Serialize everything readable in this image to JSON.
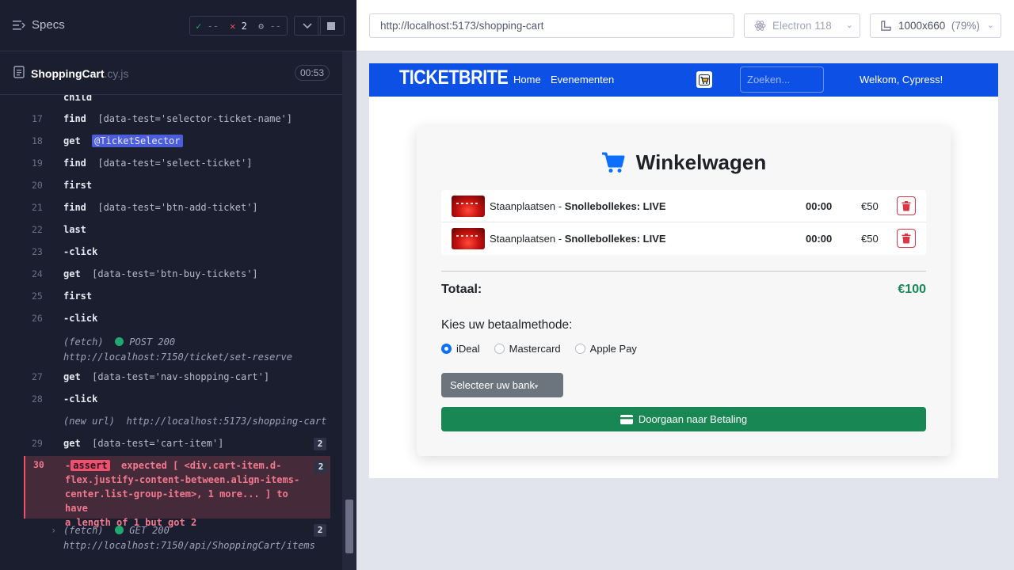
{
  "runner": {
    "specs_label": "Specs",
    "stats": {
      "passed": "--",
      "failed": "2",
      "pending": "--"
    },
    "spec_file": {
      "name": "ShoppingCart",
      "ext": ".cy.js"
    },
    "duration": "00:53",
    "commands": [
      {
        "ln": "",
        "cmd": "child",
        "arg": ""
      },
      {
        "ln": "17",
        "cmd": "find",
        "arg": "[data-test='selector-ticket-name']"
      },
      {
        "ln": "18",
        "cmd": "get",
        "alias": "@TicketSelector"
      },
      {
        "ln": "19",
        "cmd": "find",
        "arg": "[data-test='select-ticket']"
      },
      {
        "ln": "20",
        "cmd": "first",
        "arg": ""
      },
      {
        "ln": "21",
        "cmd": "find",
        "arg": "[data-test='btn-add-ticket']"
      },
      {
        "ln": "22",
        "cmd": "last",
        "arg": ""
      },
      {
        "ln": "23",
        "cmd": "-click",
        "arg": ""
      },
      {
        "ln": "24",
        "cmd": "get",
        "arg": "[data-test='btn-buy-tickets']"
      },
      {
        "ln": "25",
        "cmd": "first",
        "arg": ""
      },
      {
        "ln": "26",
        "cmd": "-click",
        "arg": ""
      },
      {
        "ln": "27",
        "cmd": "get",
        "arg": "[data-test='nav-shopping-cart']"
      },
      {
        "ln": "28",
        "cmd": "-click",
        "arg": ""
      },
      {
        "ln": "29",
        "cmd": "get",
        "arg": "[data-test='cart-item']",
        "count": "2"
      }
    ],
    "fetch1": {
      "label": "(fetch)",
      "method": "POST 200",
      "url": "http://localhost:7150/ticket/set-reserve"
    },
    "new_url": {
      "label": "(new url)",
      "url": "http://localhost:5173/shopping-cart"
    },
    "error": {
      "ln": "30",
      "tag": "assert",
      "line1": "expected [ <div.cart-item.d-",
      "line2": "flex.justify-content-between.align-items-",
      "line3": "center.list-group-item>, 1 more... ] to have",
      "line4": "a length of 1 but got 2",
      "count": "2"
    },
    "fetch2": {
      "label": "(fetch)",
      "method": "GET 200",
      "url": "http://localhost:7150/api/ShoppingCart/items",
      "count": "2"
    }
  },
  "aut": {
    "url": "http://localhost:5173/shopping-cart",
    "browser": "Electron 118",
    "viewport": "1000x660",
    "zoom": "(79%)"
  },
  "app": {
    "brand": "TICKETBRITE",
    "nav": {
      "home": "Home",
      "events": "Evenementen"
    },
    "search_placeholder": "Zoeken...",
    "welcome": "Welkom, Cypress!",
    "cart_title": "Winkelwagen",
    "items": [
      {
        "type": "Staanplaatsen",
        "sep": " - ",
        "event": "Snollebollekes: LIVE",
        "time": "00:00",
        "price": "€50"
      },
      {
        "type": "Staanplaatsen",
        "sep": " - ",
        "event": "Snollebollekes: LIVE",
        "time": "00:00",
        "price": "€50"
      }
    ],
    "total_label": "Totaal:",
    "total_value": "€100",
    "payment_label": "Kies uw betaalmethode:",
    "payment_options": [
      "iDeal",
      "Mastercard",
      "Apple Pay"
    ],
    "payment_selected": "iDeal",
    "bank_select": "Selecteer uw bank",
    "pay_button": "Doorgaan naar Betaling",
    "colors": {
      "navbar": "#0d50e6",
      "success": "#198754",
      "danger": "#dc3545",
      "primary": "#0d6efd"
    }
  }
}
